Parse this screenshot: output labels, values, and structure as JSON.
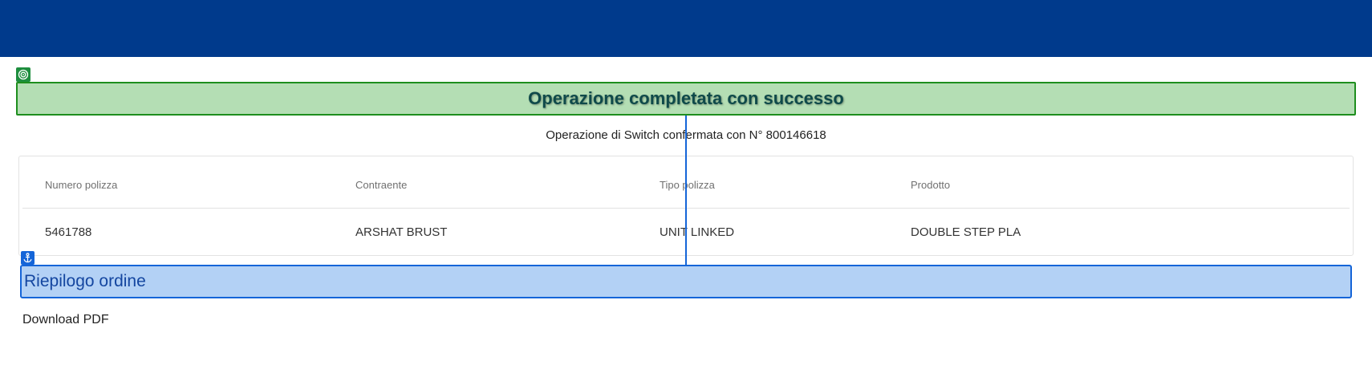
{
  "colors": {
    "header_bg": "#003a8c",
    "success_bg": "#b4deb4",
    "success_border": "#1e8e1e",
    "success_text": "#0f4a4a",
    "summary_bg": "#b3d1f5",
    "summary_border": "#1565d8",
    "summary_text": "#1446a0"
  },
  "success": {
    "icon": "target-icon",
    "title": "Operazione completata con successo",
    "message": "Operazione di Switch confermata con N° 800146618"
  },
  "policy_table": {
    "headers": [
      "Numero polizza",
      "Contraente",
      "Tipo polizza",
      "Prodotto"
    ],
    "row": [
      "5461788",
      "ARSHAT BRUST",
      "UNIT LINKED",
      "DOUBLE STEP PLA"
    ]
  },
  "summary": {
    "icon": "anchor-icon",
    "title": "Riepilogo ordine",
    "download_label": "Download PDF"
  }
}
